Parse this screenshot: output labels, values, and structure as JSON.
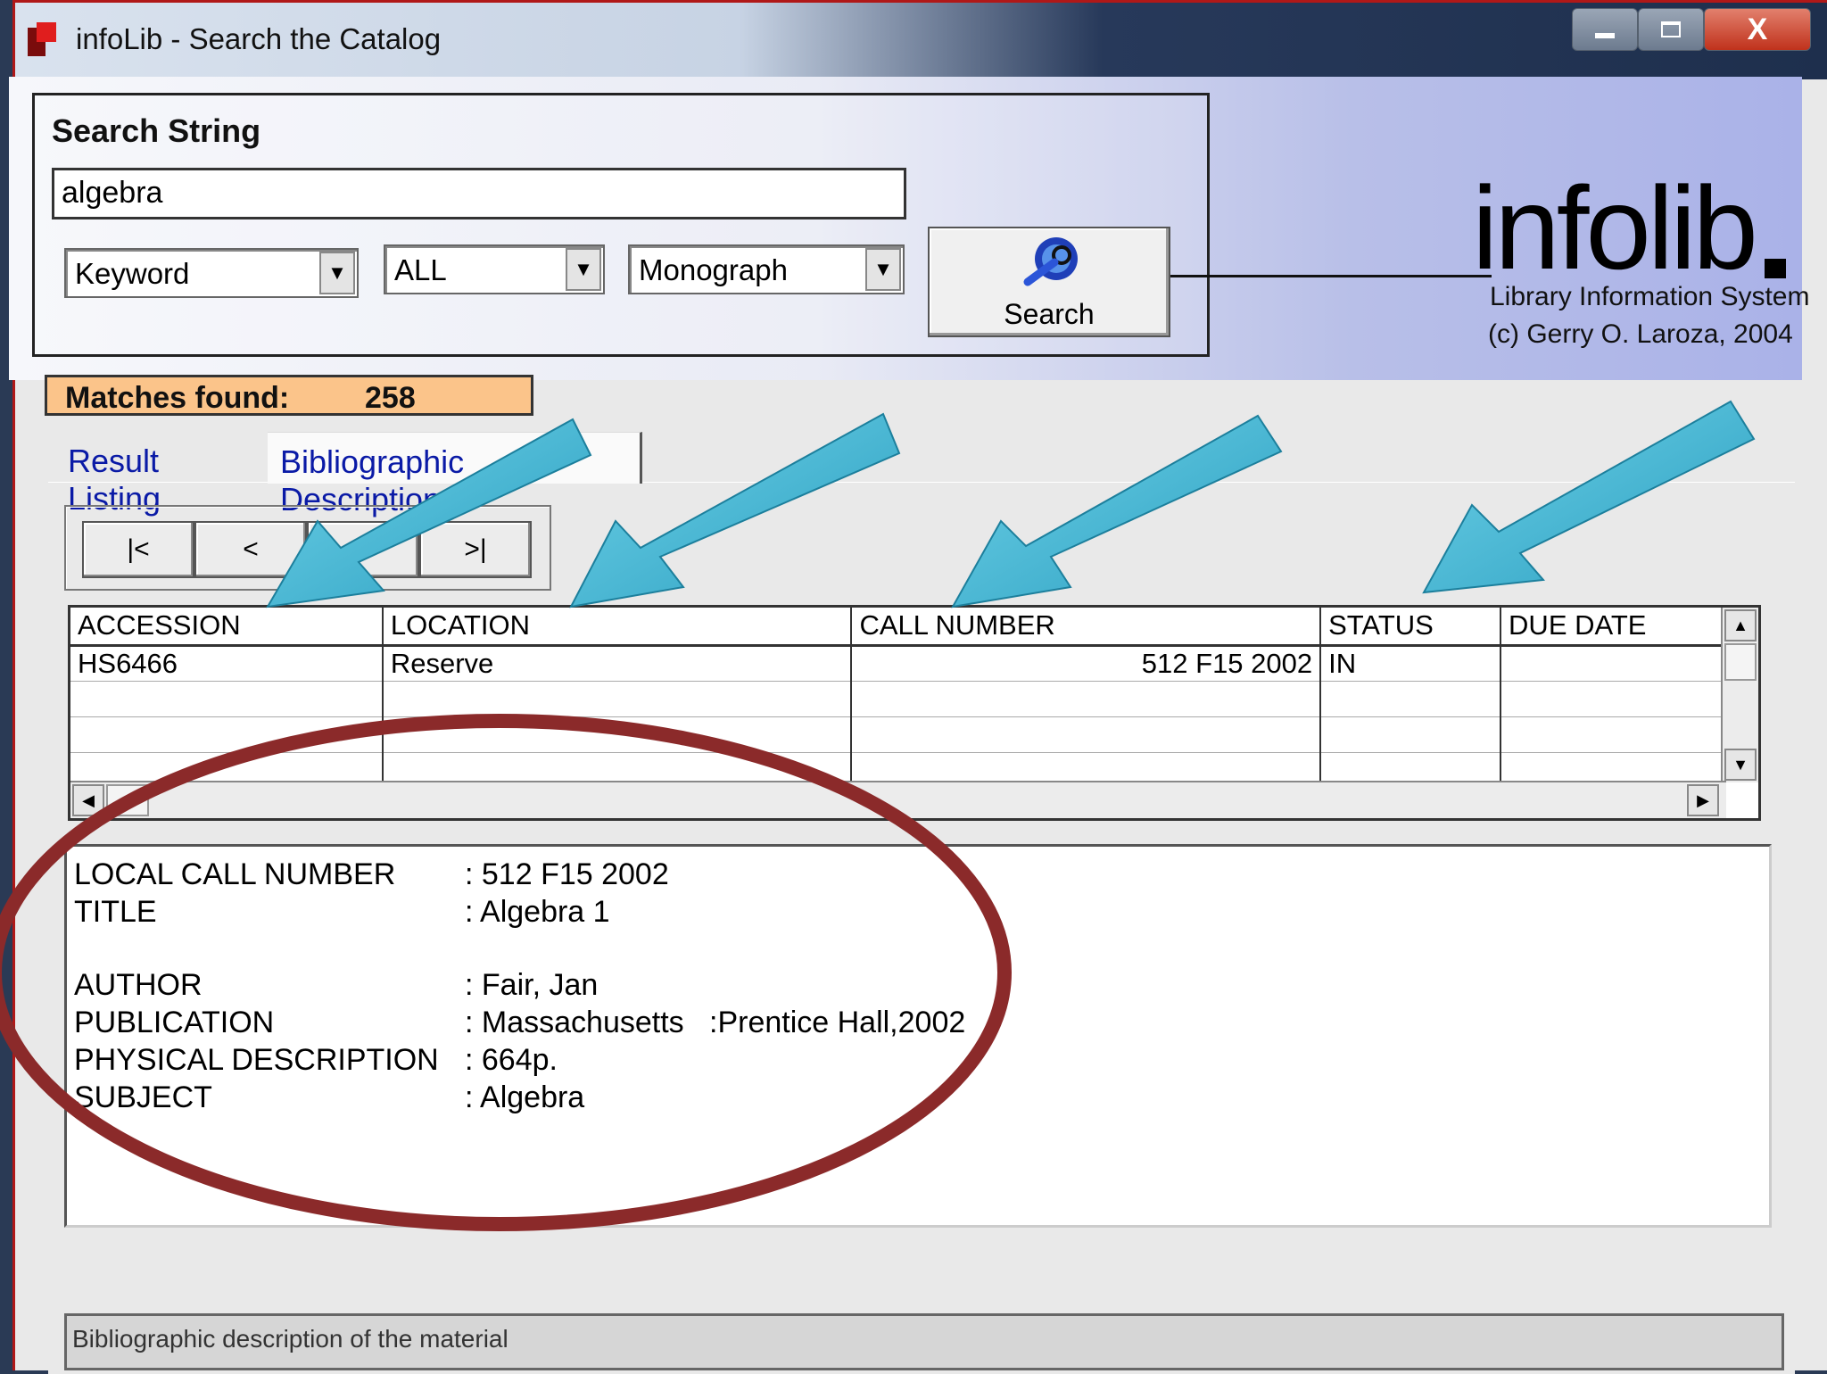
{
  "window": {
    "title": "infoLib - Search the Catalog",
    "close_glyph": "X"
  },
  "search": {
    "label": "Search String",
    "value": "algebra",
    "search_type": "Keyword",
    "scope": "ALL",
    "material_type": "Monograph",
    "button_label": "Search"
  },
  "branding": {
    "logo_text": "infolib",
    "subtitle": "Library Information System",
    "copyright": "(c) Gerry O. Laroza, 2004"
  },
  "matches": {
    "label": "Matches found:",
    "count": "258"
  },
  "tabs": [
    {
      "label": "Result Listing"
    },
    {
      "label": "Bibliographic Description"
    }
  ],
  "navigation": {
    "first": "|<",
    "prev": "<",
    "next": ">",
    "last": ">|"
  },
  "holdings_table": {
    "columns": [
      "ACCESSION",
      "LOCATION",
      "CALL NUMBER",
      "STATUS",
      "DUE DATE"
    ],
    "rows": [
      [
        "HS6466",
        "Reserve",
        "512 F15 2002",
        "IN",
        ""
      ]
    ]
  },
  "record": [
    {
      "key": "LOCAL CALL NUMBER",
      "value": ": 512 F15 2002"
    },
    {
      "key": "TITLE",
      "value": ": Algebra 1"
    },
    {
      "key": "AUTHOR",
      "value": ": Fair, Jan"
    },
    {
      "key": "PUBLICATION",
      "value": ": Massachusetts   :Prentice Hall,2002"
    },
    {
      "key": "PHYSICAL DESCRIPTION",
      "value": ": 664p."
    },
    {
      "key": "SUBJECT",
      "value": ": Algebra"
    }
  ],
  "status_bar": "Bibliographic description of the material",
  "colors": {
    "matches_bg": "#fbc48a",
    "tab_text": "#0a1aa6",
    "annotation_arrow": "#3bb3d0",
    "annotation_ellipse": "#8b2a2a"
  }
}
